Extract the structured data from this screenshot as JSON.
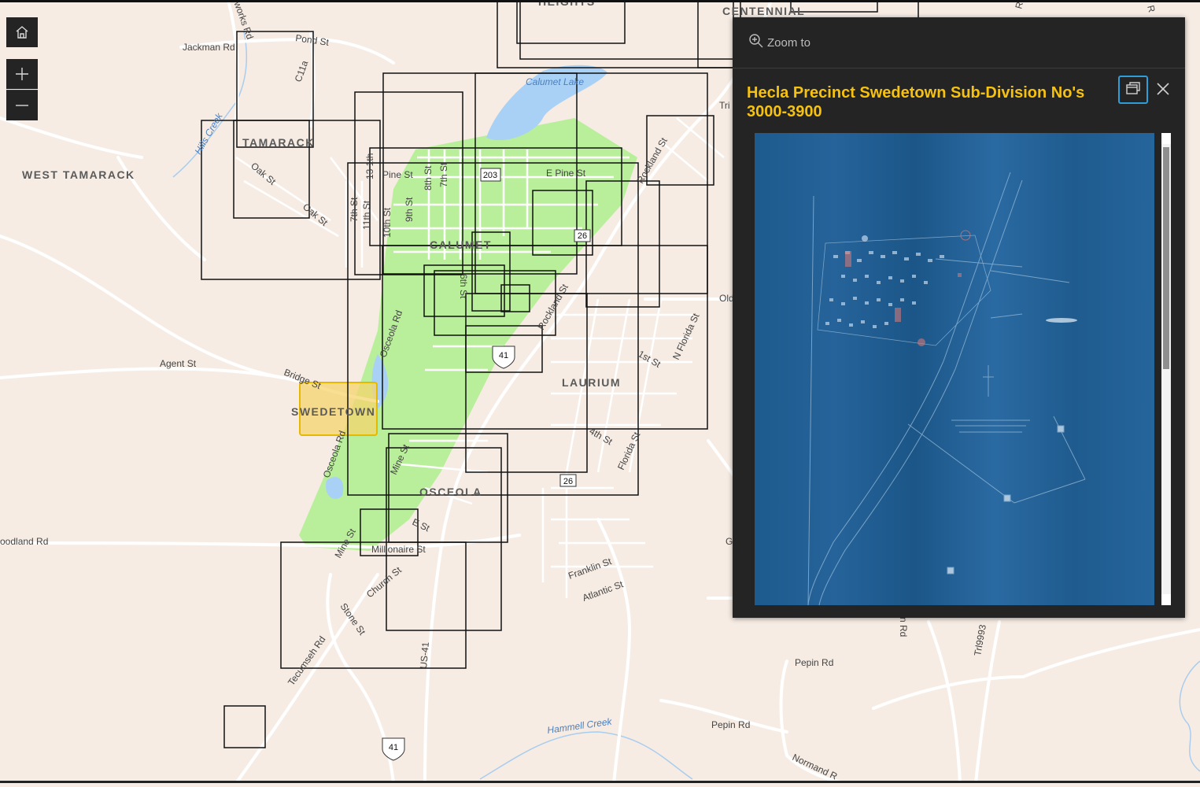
{
  "map": {
    "road_labels": [
      "Jackman Rd",
      "Pond St",
      "C11a",
      "Hills Creek",
      "Oak St",
      "Oak St",
      "Pine St",
      "E Pine St",
      "8th St",
      "7th St",
      "9th St",
      "10th St",
      "11th St",
      "7th St",
      "13 1th",
      "Rockland St",
      "Rockland St",
      "6th St",
      "Osceola Rd",
      "Agent St",
      "Bridge St",
      "Osceola Rd",
      "Mine St",
      "E St",
      "Mine St",
      "Millionaire St",
      "Church St",
      "Stone St",
      "Tecumseh Rd",
      "US-41",
      "Franklin St",
      "Atlantic St",
      "Florida St",
      "N Florida St",
      "1st St",
      "4th St",
      "Pepin Rd",
      "Pepin Rd",
      "Hammell Creek",
      "Normand R",
      "oodland Rd",
      "Calumet Lake",
      "Tri",
      "Old",
      "G",
      "n Rd",
      "Trl9993",
      "rworks Rd",
      "R",
      "R"
    ],
    "place_labels": [
      "WEST TAMARACK",
      "TAMARACK",
      "CALUMET",
      "LAURIUM",
      "SWEDETOWN",
      "OSCEOLA",
      "HEIGHTS",
      "CENTENNIAL"
    ],
    "shield_labels": [
      "203",
      "26",
      "26",
      "41",
      "41"
    ],
    "highlighted_area": "SWEDETOWN"
  },
  "controls": {
    "home_icon": "home-icon",
    "zoom_in_icon": "plus-icon",
    "zoom_out_icon": "minus-icon"
  },
  "popup": {
    "zoom_to_label": "Zoom to",
    "title": "Hecla Precinct Swedetown Sub-Division No's 3000-3900",
    "dock_icon": "dock-icon",
    "close_icon": "close-icon",
    "image_alt": "scanned blueprint map"
  },
  "colors": {
    "map_background": "#f6ece4",
    "park_green": "#b9ef9b",
    "water_blue": "#a9d1f5",
    "highlight_fill": "#f6d46d",
    "highlight_stroke": "#e6b800",
    "popup_background": "#242424",
    "title_color": "#f6c20f",
    "accent_blue": "#2e9dd8",
    "blueprint_blue": "#1f5b8e"
  }
}
